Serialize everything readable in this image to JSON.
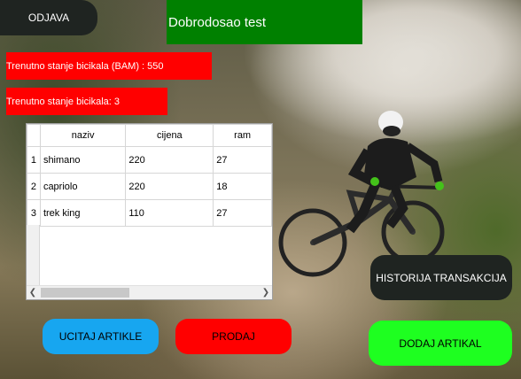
{
  "header": {
    "logout_label": "ODJAVA",
    "welcome_text": "Dobrodosao test"
  },
  "stats": {
    "value_text": "Trenutno stanje bicikala (BAM) : 550",
    "count_text": "Trenutno stanje bicikala: 3"
  },
  "table": {
    "columns": [
      "naziv",
      "cijena",
      "ram"
    ],
    "rows": [
      {
        "index": "1",
        "naziv": "shimano",
        "cijena": "220",
        "ram": "27"
      },
      {
        "index": "2",
        "naziv": "capriolo",
        "cijena": "220",
        "ram": "18"
      },
      {
        "index": "3",
        "naziv": "trek king",
        "cijena": "110",
        "ram": "27"
      }
    ],
    "scroll_left_icon": "chevron-left-icon",
    "scroll_right_icon": "chevron-right-icon"
  },
  "actions": {
    "history_label": "HISTORIJA TRANSAKCIJA",
    "load_label": "UCITAJ ARTIKLE",
    "sell_label": "PRODAJ",
    "add_label": "DODAJ ARTIKAL"
  },
  "colors": {
    "welcome_bg": "#008000",
    "stat_bg": "#ff0000",
    "dark_button": "#1f2421",
    "load_button": "#17a6f0",
    "sell_button": "#ff0000",
    "add_button": "#1eff20"
  }
}
